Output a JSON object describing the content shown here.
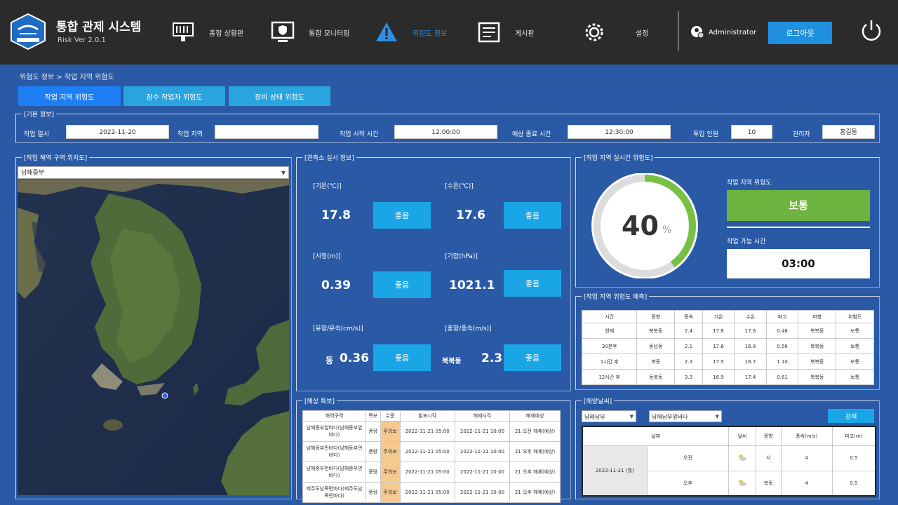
{
  "header": {
    "title": "통합 관제 시스템",
    "version": "Risk Ver 2.0.1",
    "nav": [
      {
        "label": "종합 상황판",
        "icon": "dashboard-icon"
      },
      {
        "label": "통합 모니터링",
        "icon": "monitor-icon"
      },
      {
        "label": "위험도 정보",
        "icon": "warning-icon"
      },
      {
        "label": "게시판",
        "icon": "board-icon"
      },
      {
        "label": "설정",
        "icon": "gear-icon"
      }
    ],
    "user": "Administrator",
    "logout": "로그아웃"
  },
  "breadcrumb": "위험도 정보 > 작업 지역 위험도",
  "tabs": [
    "작업 지역 위험도",
    "잠수 작업자 위험도",
    "장비 상태 위험도"
  ],
  "basic_info": {
    "legend": "[기본 정보]",
    "fields": [
      {
        "label": "작업 일시",
        "value": "2022-11-20"
      },
      {
        "label": "작업 지역",
        "value": ""
      },
      {
        "label": "작업 시작 시간",
        "value": "12:00:00"
      },
      {
        "label": "예상 종료 시간",
        "value": "12:30:00"
      },
      {
        "label": "투입 인원",
        "value": "10"
      },
      {
        "label": "관리자",
        "value": "홍길동"
      }
    ]
  },
  "map": {
    "legend": "[작업 해역 구역 위치도]",
    "select": "남해중부"
  },
  "weather": {
    "legend": "[관측소 실시 정보]",
    "items": [
      {
        "label": "[기온(℃)]",
        "value": "17.8",
        "status": "좋음"
      },
      {
        "label": "[수온(℃)]",
        "value": "17.6",
        "status": "좋음"
      },
      {
        "label": "[시정(m)]",
        "value": "0.39",
        "status": "좋음"
      },
      {
        "label": "[기압(hPa)]",
        "value": "1021.1",
        "status": "좋음"
      },
      {
        "label": "[유향/유속(cm/s)]",
        "dir": "동",
        "value": "0.36",
        "status": "좋음"
      },
      {
        "label": "[풍향/풍속(m/s)]",
        "dir": "북북동",
        "value": "2.3",
        "status": "좋음"
      }
    ]
  },
  "risk": {
    "legend": "[작업 지역 실시간 위험도]",
    "percent": "40",
    "percent_fraction": 0.4,
    "unit": "%",
    "risk_label": "작업 지역 위험도",
    "risk_value": "보통",
    "time_label": "작업 가능 시간",
    "time_value": "03:00"
  },
  "forecast": {
    "legend": "[작업 지역 위험도 예측]",
    "headers": [
      "시간",
      "풍향",
      "풍속",
      "기온",
      "수온",
      "파고",
      "파향",
      "위험도"
    ],
    "rows": [
      [
        "현재",
        "북북동",
        "2.4",
        "17.8",
        "17.6",
        "0.46",
        "북북동",
        "보통"
      ],
      [
        "30분후",
        "동남동",
        "2.1",
        "17.6",
        "16.8",
        "0.56",
        "북북동",
        "보통"
      ],
      [
        "1시간 후",
        "북동",
        "2.3",
        "17.5",
        "16.7",
        "1.10",
        "북북동",
        "보통"
      ],
      [
        "12시간 후",
        "동북동",
        "3.3",
        "16.9",
        "17.4",
        "0.61",
        "북북동",
        "보통"
      ]
    ]
  },
  "special": {
    "legend": "[해상 특보]",
    "headers": [
      "해역구역",
      "특보",
      "수준",
      "발표시각",
      "해제시각",
      "해제예상"
    ],
    "rows": [
      [
        "남해동부앞바다(남해동부앞바다)",
        "풍랑",
        "주의보",
        "2022-11-21 05:00",
        "2022-11-21 10:00",
        "21 오전 해제(예상)"
      ],
      [
        "남해동부먼바다(남해동부먼바다)",
        "풍랑",
        "주의보",
        "2022-11-21 05:00",
        "2022-11-21 10:00",
        "21 오후 해제(예상)"
      ],
      [
        "남해중부먼바다(남해중부먼바다)",
        "풍랑",
        "주의보",
        "2022-11-21 05:00",
        "2022-11-21 10:00",
        "21 오후 해제(예상)"
      ],
      [
        "제주도남쪽먼바다(제주도남쪽먼바다)",
        "풍랑",
        "주의보",
        "2022-11-21 05:00",
        "2022-11-21 10:00",
        "21 오후 해제(예상)"
      ]
    ]
  },
  "tide": {
    "legend": "[해양날씨]",
    "select1": "남해남부",
    "select2": "남해남부앞바다",
    "search": "검색",
    "headers": [
      "날짜",
      "",
      "날씨",
      "풍향",
      "풍속(m/s)",
      "파고(m)"
    ],
    "date": "2022-11-21 (월)",
    "rows": [
      [
        "오전",
        "cloud-icon",
        "서",
        "4",
        "0.5"
      ],
      [
        "오후",
        "cloud-icon",
        "북동",
        "4",
        "0.5"
      ]
    ]
  }
}
